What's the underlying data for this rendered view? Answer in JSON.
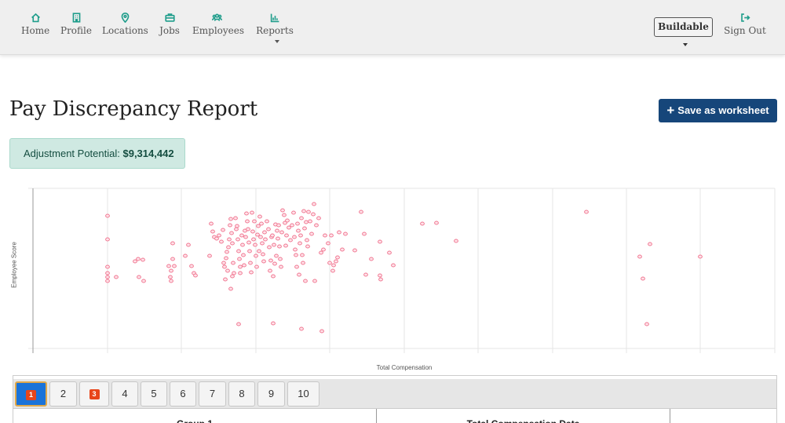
{
  "nav": {
    "items": [
      {
        "label": "Home",
        "icon": "home-icon"
      },
      {
        "label": "Profile",
        "icon": "building-icon"
      },
      {
        "label": "Locations",
        "icon": "map-pin-icon"
      },
      {
        "label": "Jobs",
        "icon": "briefcase-icon"
      },
      {
        "label": "Employees",
        "icon": "users-icon"
      },
      {
        "label": "Reports",
        "icon": "bar-chart-icon"
      }
    ],
    "tenant": "Buildable",
    "signout": "Sign Out",
    "accent": "#1f9d8b"
  },
  "page": {
    "title": "Pay Discrepancy Report",
    "save_label": "Save as worksheet",
    "adjustment_label": "Adjustment Potential:",
    "adjustment_value": "$9,314,442"
  },
  "chart_data": {
    "type": "scatter",
    "xlabel": "Total Compensation",
    "ylabel": "Employee Score",
    "grid": true,
    "marker_color": "#f07892",
    "points": [
      [
        137,
        275
      ],
      [
        137,
        305
      ],
      [
        137,
        340
      ],
      [
        137,
        348
      ],
      [
        137,
        353
      ],
      [
        137,
        358
      ],
      [
        148,
        353
      ],
      [
        172,
        333
      ],
      [
        176,
        330
      ],
      [
        182,
        331
      ],
      [
        177,
        353
      ],
      [
        183,
        358
      ],
      [
        215,
        339
      ],
      [
        217,
        353
      ],
      [
        218,
        345
      ],
      [
        220,
        310
      ],
      [
        220,
        330
      ],
      [
        218,
        358
      ],
      [
        222,
        339
      ],
      [
        236,
        326
      ],
      [
        240,
        312
      ],
      [
        244,
        339
      ],
      [
        247,
        348
      ],
      [
        249,
        351
      ],
      [
        267,
        326
      ],
      [
        269,
        285
      ],
      [
        271,
        295
      ],
      [
        273,
        302
      ],
      [
        276,
        304
      ],
      [
        279,
        300
      ],
      [
        282,
        308
      ],
      [
        284,
        293
      ],
      [
        285,
        335
      ],
      [
        286,
        340
      ],
      [
        287,
        356
      ],
      [
        288,
        329
      ],
      [
        289,
        321
      ],
      [
        290,
        345
      ],
      [
        291,
        315
      ],
      [
        292,
        305
      ],
      [
        293,
        287
      ],
      [
        294,
        279
      ],
      [
        295,
        297
      ],
      [
        296,
        310
      ],
      [
        296,
        352
      ],
      [
        297,
        335
      ],
      [
        294,
        368
      ],
      [
        298,
        348
      ],
      [
        300,
        278
      ],
      [
        301,
        292
      ],
      [
        302,
        288
      ],
      [
        303,
        305
      ],
      [
        304,
        320
      ],
      [
        305,
        330
      ],
      [
        306,
        340
      ],
      [
        306,
        348
      ],
      [
        308,
        300
      ],
      [
        309,
        312
      ],
      [
        310,
        325
      ],
      [
        311,
        338
      ],
      [
        312,
        294
      ],
      [
        313,
        302
      ],
      [
        314,
        272
      ],
      [
        315,
        282
      ],
      [
        316,
        292
      ],
      [
        317,
        309
      ],
      [
        318,
        320
      ],
      [
        319,
        335
      ],
      [
        320,
        347
      ],
      [
        321,
        271
      ],
      [
        322,
        295
      ],
      [
        323,
        305
      ],
      [
        324,
        282
      ],
      [
        325,
        312
      ],
      [
        326,
        326
      ],
      [
        327,
        340
      ],
      [
        328,
        299
      ],
      [
        329,
        288
      ],
      [
        330,
        320
      ],
      [
        331,
        276
      ],
      [
        332,
        302
      ],
      [
        333,
        285
      ],
      [
        334,
        310
      ],
      [
        335,
        324
      ],
      [
        336,
        333
      ],
      [
        337,
        296
      ],
      [
        338,
        305
      ],
      [
        340,
        282
      ],
      [
        342,
        292
      ],
      [
        343,
        315
      ],
      [
        344,
        345
      ],
      [
        345,
        332
      ],
      [
        346,
        302
      ],
      [
        347,
        300
      ],
      [
        348,
        352
      ],
      [
        349,
        312
      ],
      [
        350,
        336
      ],
      [
        351,
        286
      ],
      [
        352,
        326
      ],
      [
        353,
        294
      ],
      [
        354,
        304
      ],
      [
        355,
        287
      ],
      [
        356,
        314
      ],
      [
        357,
        330
      ],
      [
        358,
        340
      ],
      [
        359,
        296
      ],
      [
        360,
        268
      ],
      [
        362,
        274
      ],
      [
        363,
        284
      ],
      [
        364,
        313
      ],
      [
        365,
        300
      ],
      [
        366,
        281
      ],
      [
        368,
        290
      ],
      [
        370,
        306
      ],
      [
        372,
        287
      ],
      [
        374,
        271
      ],
      [
        375,
        302
      ],
      [
        376,
        318
      ],
      [
        377,
        325
      ],
      [
        378,
        340
      ],
      [
        379,
        285
      ],
      [
        380,
        294
      ],
      [
        381,
        350
      ],
      [
        382,
        310
      ],
      [
        383,
        300
      ],
      [
        384,
        278
      ],
      [
        385,
        325
      ],
      [
        386,
        335
      ],
      [
        387,
        269
      ],
      [
        388,
        291
      ],
      [
        389,
        358
      ],
      [
        390,
        283
      ],
      [
        391,
        306
      ],
      [
        392,
        314
      ],
      [
        393,
        270
      ],
      [
        395,
        282
      ],
      [
        397,
        298
      ],
      [
        399,
        273
      ],
      [
        400,
        260
      ],
      [
        401,
        358
      ],
      [
        403,
        287
      ],
      [
        406,
        278
      ],
      [
        409,
        322
      ],
      [
        412,
        318
      ],
      [
        414,
        300
      ],
      [
        418,
        310
      ],
      [
        420,
        335
      ],
      [
        422,
        300
      ],
      [
        424,
        345
      ],
      [
        425,
        338
      ],
      [
        428,
        333
      ],
      [
        430,
        328
      ],
      [
        432,
        296
      ],
      [
        436,
        318
      ],
      [
        440,
        298
      ],
      [
        452,
        319
      ],
      [
        460,
        270
      ],
      [
        464,
        298
      ],
      [
        466,
        350
      ],
      [
        473,
        330
      ],
      [
        484,
        308
      ],
      [
        484,
        351
      ],
      [
        485,
        356
      ],
      [
        496,
        322
      ],
      [
        501,
        338
      ],
      [
        538,
        285
      ],
      [
        556,
        284
      ],
      [
        581,
        307
      ],
      [
        304,
        413
      ],
      [
        348,
        412
      ],
      [
        384,
        419
      ],
      [
        410,
        422
      ],
      [
        747,
        270
      ],
      [
        815,
        327
      ],
      [
        828,
        311
      ],
      [
        819,
        355
      ],
      [
        824,
        413
      ],
      [
        892,
        327
      ]
    ]
  },
  "tabs": [
    {
      "label": "1",
      "badge": true,
      "active": true
    },
    {
      "label": "2",
      "badge": false,
      "active": false
    },
    {
      "label": "3",
      "badge": true,
      "active": false
    },
    {
      "label": "4",
      "badge": false,
      "active": false
    },
    {
      "label": "5",
      "badge": false,
      "active": false
    },
    {
      "label": "6",
      "badge": false,
      "active": false
    },
    {
      "label": "7",
      "badge": false,
      "active": false
    },
    {
      "label": "8",
      "badge": false,
      "active": false
    },
    {
      "label": "9",
      "badge": false,
      "active": false
    },
    {
      "label": "10",
      "badge": false,
      "active": false
    }
  ],
  "table": {
    "headers": [
      "Group 1",
      "Total Compensation Data",
      ""
    ]
  }
}
